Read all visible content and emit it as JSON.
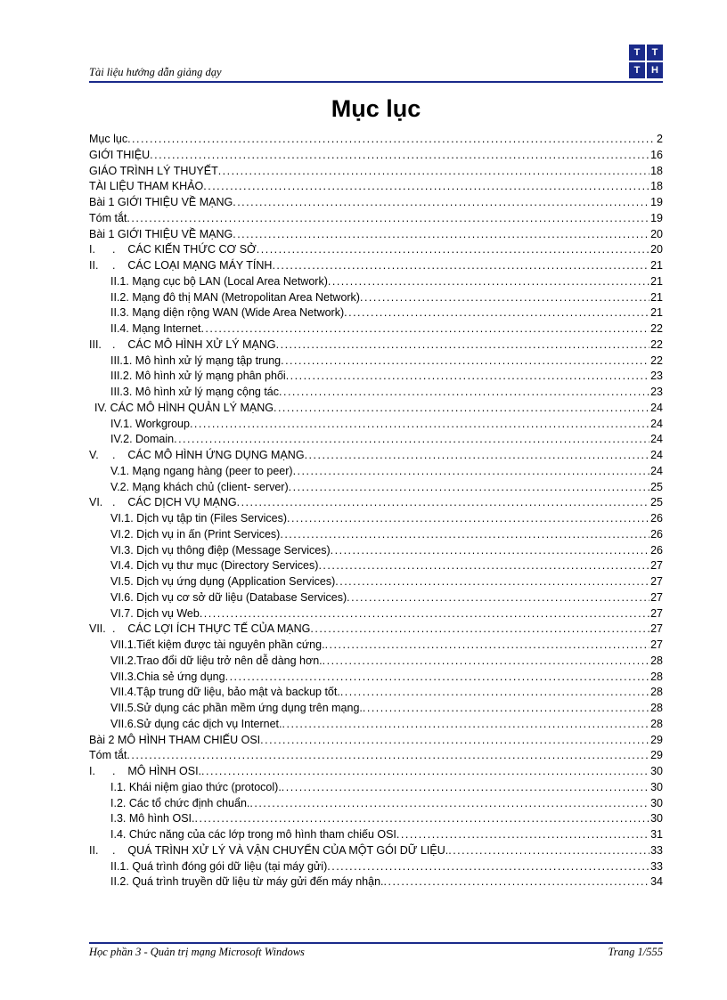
{
  "header": {
    "text": "Tài liệu hướng dẫn giảng dạy"
  },
  "logo": {
    "tl": "T",
    "tr": "T",
    "bl": "T",
    "br": "H"
  },
  "title": "Mục lục",
  "toc": [
    {
      "level": 0,
      "label": "Mục lục",
      "page": "2"
    },
    {
      "level": 0,
      "label": "GIỚI THIỆU",
      "page": "16"
    },
    {
      "level": 0,
      "label": "GIÁO TRÌNH  LÝ THUYẾT",
      "page": "18"
    },
    {
      "level": 0,
      "label": "TÀI LIỆU THAM KHẢO",
      "page": "18"
    },
    {
      "level": 0,
      "label": "Bài 1 GIỚI THIỆU VỀ MẠNG",
      "page": "19"
    },
    {
      "level": 0,
      "label": "Tóm tắt",
      "page": "19"
    },
    {
      "level": 0,
      "label": "Bài 1 GIỚI THIỆU VỀ MẠNG",
      "page": "20"
    },
    {
      "level": 1,
      "roman": "I",
      "label": "CÁC KIẾN THỨC CƠ SỞ",
      "page": "20"
    },
    {
      "level": 1,
      "roman": "II",
      "label": "CÁC LOẠI MẠNG MÁY TÍNH",
      "page": "21"
    },
    {
      "level": 2,
      "label": "II.1.  Mạng cục bộ LAN (Local Area Network)",
      "page": "21"
    },
    {
      "level": 2,
      "label": "II.2.  Mạng đô thị MAN (Metropolitan Area Network)",
      "page": "21"
    },
    {
      "level": 2,
      "label": "II.3.  Mạng diện rộng WAN (Wide Area Network)",
      "page": "21"
    },
    {
      "level": 2,
      "label": "II.4.  Mạng Internet",
      "page": "22"
    },
    {
      "level": 1,
      "roman": "III",
      "label": "CÁC MÔ HÌNH XỬ LÝ MẠNG",
      "page": "22"
    },
    {
      "level": 2,
      "label": "III.1.  Mô hình  xử lý mạng tập trung",
      "page": "22"
    },
    {
      "level": 2,
      "label": "III.2.  Mô hình  xử lý mạng phân phối",
      "page": "23"
    },
    {
      "level": 2,
      "label": "III.3.  Mô hình  xử lý mạng cộng tác",
      "page": "23"
    },
    {
      "level": "1b",
      "label": "IV.   CÁC MÔ HÌNH QUẢN LÝ MẠNG",
      "page": "24"
    },
    {
      "level": 2,
      "label": "IV.1. Workgroup",
      "page": "24"
    },
    {
      "level": 2,
      "label": "IV.2. Domain",
      "page": "24"
    },
    {
      "level": 1,
      "roman": "V",
      "label": "CÁC MÔ HÌNH ỨNG DỤNG MẠNG",
      "page": "24"
    },
    {
      "level": 2,
      "label": "V.1.   Mạng ngang hàng (peer to peer)",
      "page": "24"
    },
    {
      "level": 2,
      "label": "V.2.   Mạng khách chủ (client- server)",
      "page": "25"
    },
    {
      "level": 1,
      "roman": "VI",
      "label": "CÁC DỊCH VỤ MẠNG",
      "page": "25"
    },
    {
      "level": 2,
      "label": "VI.1. Dịch vụ tập tin (Files Services)",
      "page": "26"
    },
    {
      "level": 2,
      "label": "VI.2. Dịch vụ in ấn (Print Services)",
      "page": "26"
    },
    {
      "level": 2,
      "label": "VI.3. Dịch vụ thông điệp (Message Services)",
      "page": "26"
    },
    {
      "level": 2,
      "label": "VI.4. Dịch  vụ thư mục (Directory Services)",
      "page": "27"
    },
    {
      "level": 2,
      "label": "VI.5. Dịch vụ ứng dụng (Application Services)",
      "page": "27"
    },
    {
      "level": 2,
      "label": "VI.6. Dịch vụ cơ sở dữ liệu (Database Services)",
      "page": "27"
    },
    {
      "level": 2,
      "label": "VI.7. Dịch vụ Web",
      "page": "27"
    },
    {
      "level": 1,
      "roman": "VII",
      "label": "CÁC LỢI ÍCH THỰC TẾ CỦA MẠNG",
      "page": "27"
    },
    {
      "level": 2,
      "label": "VII.1.Tiết kiệm được tài nguyên phần cứng.",
      "page": "27"
    },
    {
      "level": 2,
      "label": "VII.2.Trao đổi dữ liệu trở nên dễ dàng hơn.",
      "page": "28"
    },
    {
      "level": 2,
      "label": "VII.3.Chia sẻ ứng dụng",
      "page": "28"
    },
    {
      "level": 2,
      "label": "VII.4.Tập trung dữ liệu, bảo mật và backup tốt.",
      "page": "28"
    },
    {
      "level": 2,
      "label": "VII.5.Sử dụng các phần mềm ứng dụng trên mạng.",
      "page": "28"
    },
    {
      "level": 2,
      "label": "VII.6.Sử dụng các dịch vụ Internet.",
      "page": "28"
    },
    {
      "level": 0,
      "label": "Bài 2 MÔ HÌNH THAM CHIẾU OSI",
      "page": "29"
    },
    {
      "level": 0,
      "label": "Tóm tắt",
      "page": "29"
    },
    {
      "level": 1,
      "roman": "I",
      "label": "MÔ HÌNH  OSI.",
      "page": "30"
    },
    {
      "level": 2,
      "label": "I.1.   Khái niệm giao thức (protocol).",
      "page": "30"
    },
    {
      "level": 2,
      "label": "I.2.   Các tổ chức định chuẩn.",
      "page": "30"
    },
    {
      "level": 2,
      "label": "I.3.   Mô hình  OSI.",
      "page": "30"
    },
    {
      "level": 2,
      "label": "I.4.   Chức năng của các lớp trong mô hình tham chiếu OSI",
      "page": "31"
    },
    {
      "level": 1,
      "roman": "II",
      "label": "QUÁ TRÌNH  XỬ LÝ VÀ VẬN CHUYỂN CỦA MỘT GÓI DỮ LIỆU.",
      "page": "33"
    },
    {
      "level": 2,
      "label": "II.1.  Quá trình đóng gói dữ liệu (tại máy gửi)",
      "page": "33"
    },
    {
      "level": 2,
      "label": "II.2.  Quá trình truyền dữ liệu từ máy gửi đến máy nhận.",
      "page": "34"
    }
  ],
  "footer": {
    "left": "Học phần 3 - Quản trị mạng Microsoft Windows",
    "right": "Trang 1/555"
  }
}
